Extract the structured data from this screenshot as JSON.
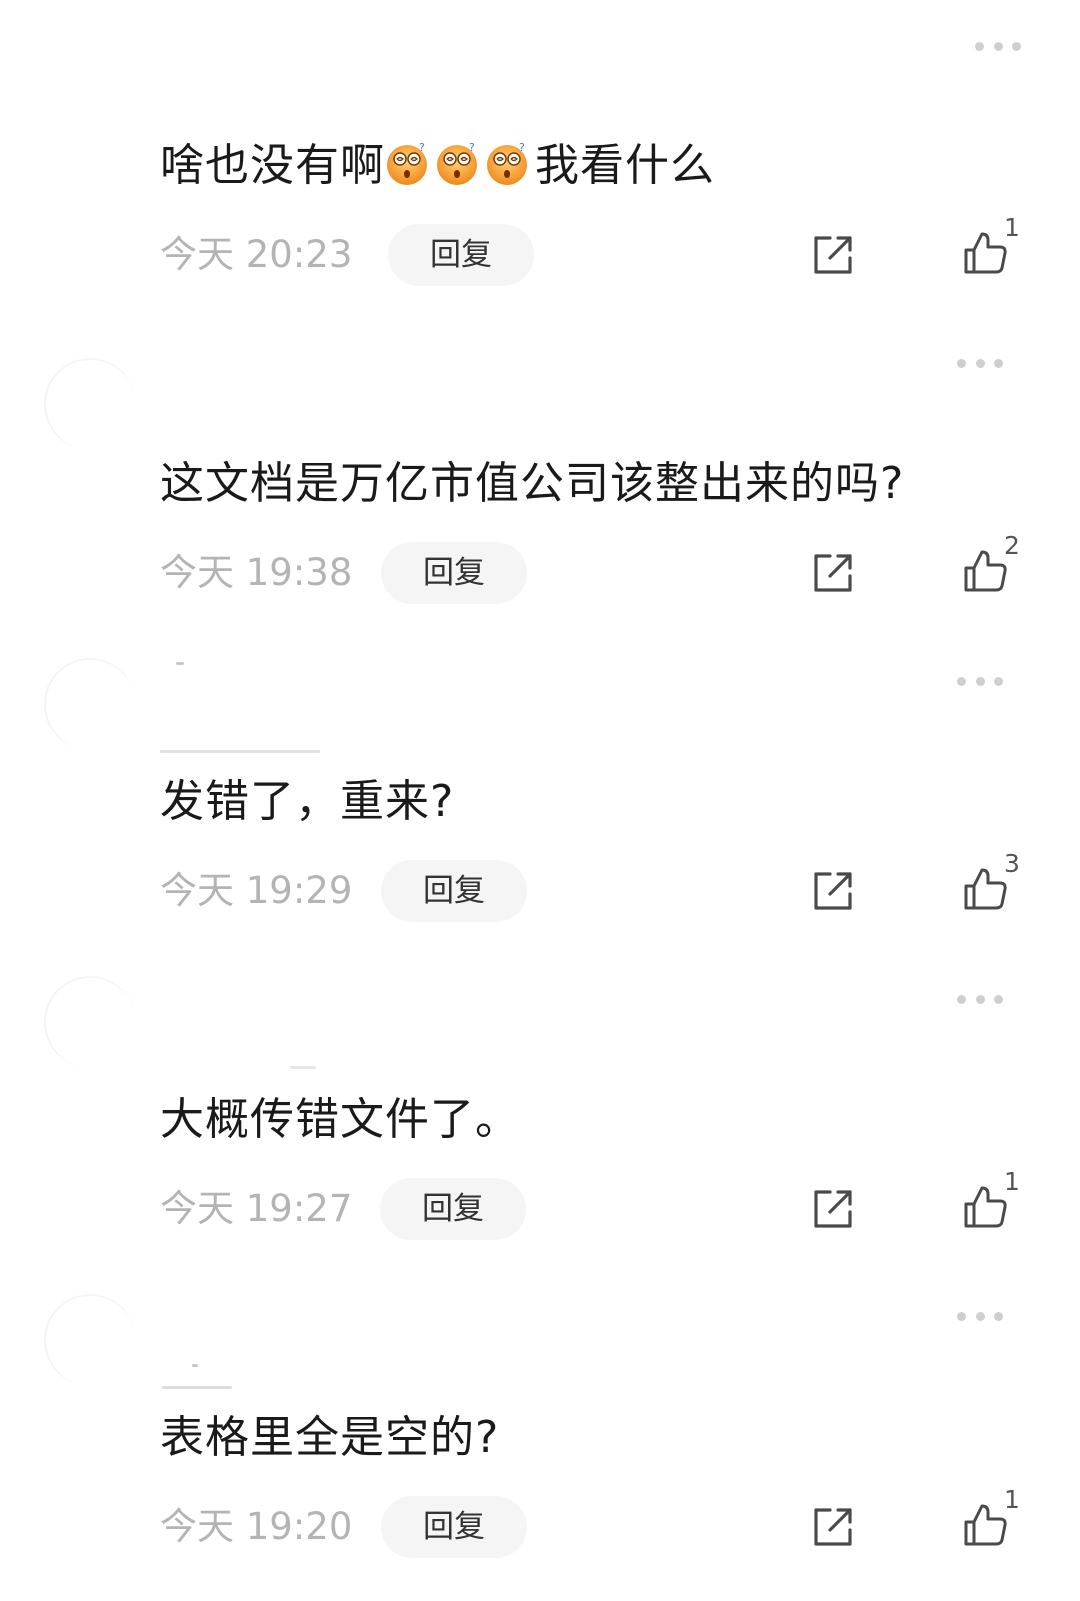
{
  "comments": [
    {
      "text": "啥也没有啊",
      "emoji_count": 3,
      "emoji_icon": "dizzy-face-emoji",
      "text_suffix": "我看什么",
      "time": "今天 20:23",
      "reply_label": "回复",
      "likes": "1"
    },
    {
      "text": "这文档是万亿市值公司该整出来的吗?",
      "time": "今天 19:38",
      "reply_label": "回复",
      "likes": "2"
    },
    {
      "text": "发错了，重来?",
      "time": "今天 19:29",
      "reply_label": "回复",
      "likes": "3"
    },
    {
      "text": "大概传错文件了。",
      "time": "今天 19:27",
      "reply_label": "回复",
      "likes": "1"
    },
    {
      "text": "表格里全是空的?",
      "time": "今天 19:20",
      "reply_label": "回复",
      "likes": "1"
    }
  ],
  "icons": {
    "more": "more-dots-icon",
    "share": "share-icon",
    "like": "thumbs-up-icon"
  },
  "colors": {
    "text": "#1a1a1a",
    "timestamp": "#b4b4b4",
    "reply_bg": "#f5f5f5",
    "icon": "#4a4a4a",
    "emoji": "#f5a623"
  }
}
